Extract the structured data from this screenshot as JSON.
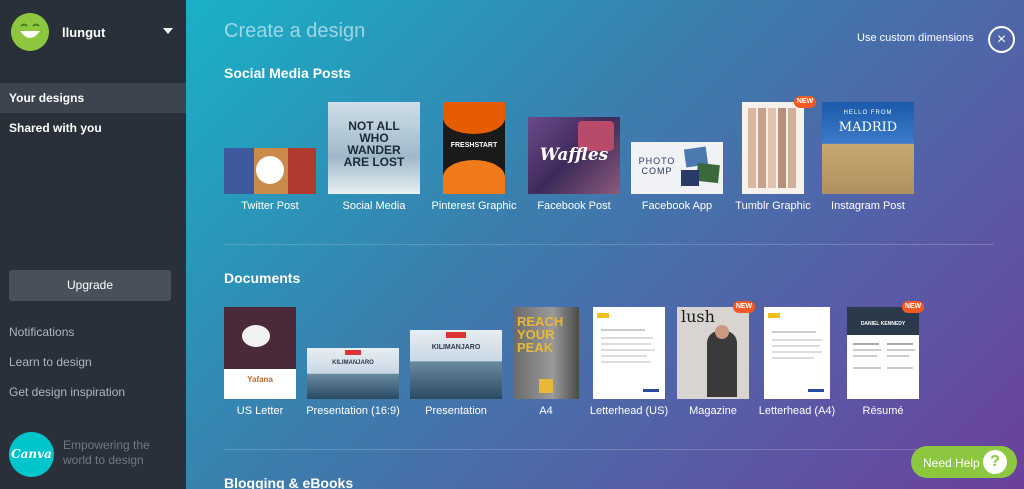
{
  "sidebar": {
    "username": "llungut",
    "nav": [
      {
        "label": "Your designs"
      },
      {
        "label": "Shared with you"
      }
    ],
    "upgrade_label": "Upgrade",
    "links": [
      {
        "label": "Notifications"
      },
      {
        "label": "Learn to design"
      },
      {
        "label": "Get design inspiration"
      }
    ],
    "logo_text": "Canva",
    "tagline": "Empowering the world to design"
  },
  "main": {
    "title": "Create a design",
    "custom_dimensions_label": "Use custom dimensions",
    "close_icon": "×",
    "sections": [
      {
        "title": "Social Media Posts",
        "items": [
          {
            "label": "Twitter Post"
          },
          {
            "label": "Social Media",
            "thumb_text": "NOT ALL WHO WANDER ARE LOST"
          },
          {
            "label": "Pinterest Graphic",
            "thumb_text": "FRESHSTART"
          },
          {
            "label": "Facebook Post",
            "thumb_text": "Waffles"
          },
          {
            "label": "Facebook App",
            "thumb_text": "PHOTO COMP"
          },
          {
            "label": "Tumblr Graphic",
            "badge": "NEW"
          },
          {
            "label": "Instagram Post",
            "thumb_text": "MADRID",
            "thumb_subtext": "HELLO FROM"
          }
        ]
      },
      {
        "title": "Documents",
        "items": [
          {
            "label": "US Letter",
            "thumb_text": "Yafana"
          },
          {
            "label": "Presentation (16:9)",
            "thumb_text": "KILIMANJARO"
          },
          {
            "label": "Presentation",
            "thumb_text": "KILIMANJARO"
          },
          {
            "label": "A4",
            "thumb_text": "REACH YOUR PEAK"
          },
          {
            "label": "Letterhead (US)"
          },
          {
            "label": "Magazine",
            "thumb_text": "lush",
            "badge": "NEW"
          },
          {
            "label": "Letterhead (A4)"
          },
          {
            "label": "Résumé",
            "thumb_text": "DANIEL KENNEDY",
            "badge": "NEW"
          }
        ]
      },
      {
        "title": "Blogging & eBooks"
      }
    ]
  },
  "help": {
    "label": "Need Help",
    "icon": "?"
  },
  "colors": {
    "sidebar_bg": "#293039",
    "accent_green": "#8dc63f",
    "badge_orange": "#f15a24",
    "canva_teal": "#00c4cc"
  }
}
